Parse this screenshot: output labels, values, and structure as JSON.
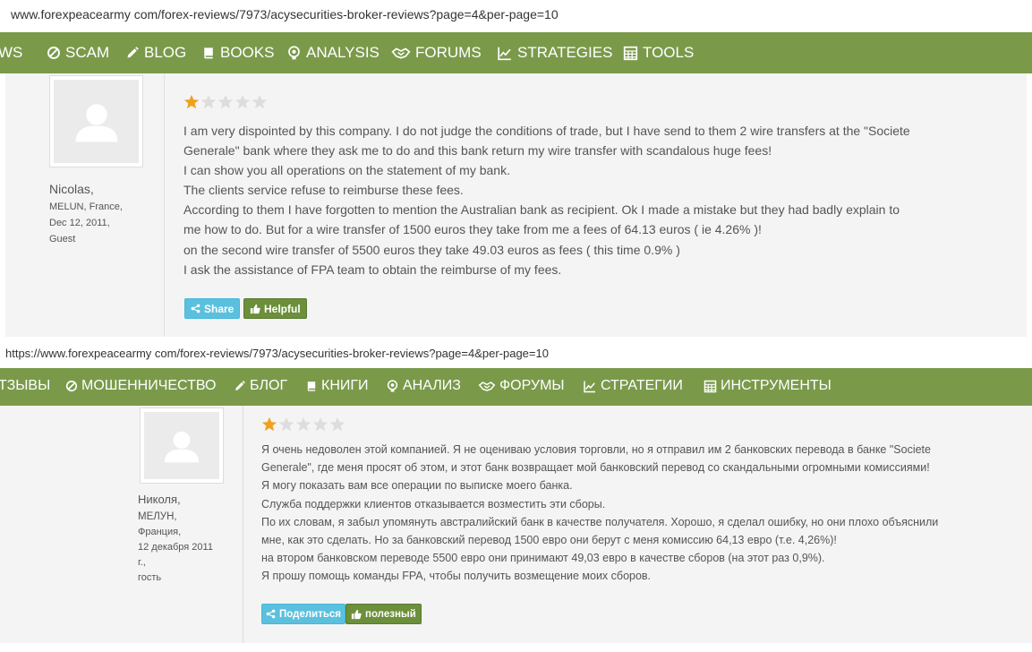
{
  "top": {
    "url": "www.forexpeacearmy com/forex-reviews/7973/acysecurities-broker-reviews?page=4&per-page=10",
    "nav": [
      "WS",
      "SCAM",
      "BLOG",
      "BOOKS",
      "ANALYSIS",
      "FORUMS",
      "STRATEGIES",
      "TOOLS"
    ],
    "rating": 1,
    "max_rating": 5,
    "author": {
      "name": "Nicolas,",
      "location": "MELUN, France,",
      "date": "Dec 12, 2011,",
      "role": "Guest"
    },
    "lines": [
      "I am very dispointed by this company. I do not judge the conditions of trade, but I have send to them 2 wire transfers at the \"Societe",
      "Generale\" bank where they ask me to do and this bank return my wire transfer with scandalous huge fees!",
      "I can show you all operations on the statement of my bank.",
      "The clients service refuse to reimburse these fees.",
      "According to them I have forgotten to mention the Australian bank as recipient. Ok I made a mistake but they had badly explain to",
      "me how to do. But for a wire transfer of 1500 euros they take from me a fees of 64.13 euros ( ie 4.26% )!",
      "on the second wire transfer of 5500 euros they take 49.03 euros as fees ( this time 0.9% )",
      "I ask the assistance of FPA team to obtain the reimburse of my fees."
    ],
    "share_label": "Share",
    "helpful_label": "Helpful"
  },
  "bottom": {
    "url": "https://www.forexpeacearmy com/forex-reviews/7973/acysecurities-broker-reviews?page=4&per-page=10",
    "nav": [
      "ТЗЫВЫ",
      "МОШЕННИЧЕСТВО",
      "БЛОГ",
      "КНИГИ",
      "АНАЛИЗ",
      "ФОРУМЫ",
      "СТРАТЕГИИ",
      "ИНСТРУМЕНТЫ"
    ],
    "rating": 1,
    "max_rating": 5,
    "author": {
      "name": "Николя,",
      "city": "МЕЛУН,",
      "country": "Франция,",
      "date": "12 декабря 2011",
      "suffix": "г.,",
      "role": "гость"
    },
    "lines": [
      "Я очень недоволен этой компанией. Я не оцениваю условия торговли, но я отправил им 2 банковских перевода в банке \"Societe",
      "Generale\", где меня просят об этом, и этот банк возвращает мой банковский перевод со скандальными огромными комиссиями!",
      "Я могу показать вам все операции по выписке моего банка.",
      "Служба поддержки клиентов отказывается возместить эти сборы.",
      "По их словам, я забыл упомянуть австралийский банк в качестве получателя. Хорошо, я сделал ошибку, но они плохо объяснили",
      "мне, как это сделать. Но за банковский перевод 1500 евро они берут с меня комиссию 64,13 евро (т.е. 4,26%)!",
      "на втором банковском переводе 5500 евро они принимают 49,03 евро в качестве сборов (на этот раз 0,9%).",
      "Я прошу помощь команды FPA, чтобы получить возмещение моих сборов."
    ],
    "share_label": "Поделиться",
    "helpful_label": "полезный"
  },
  "colors": {
    "nav_bg": "#7a9a4a",
    "star_filled": "#f0a020",
    "star_empty": "#dddddd",
    "share_bg": "#5bc0de",
    "helpful_bg": "#6b8f3a"
  }
}
